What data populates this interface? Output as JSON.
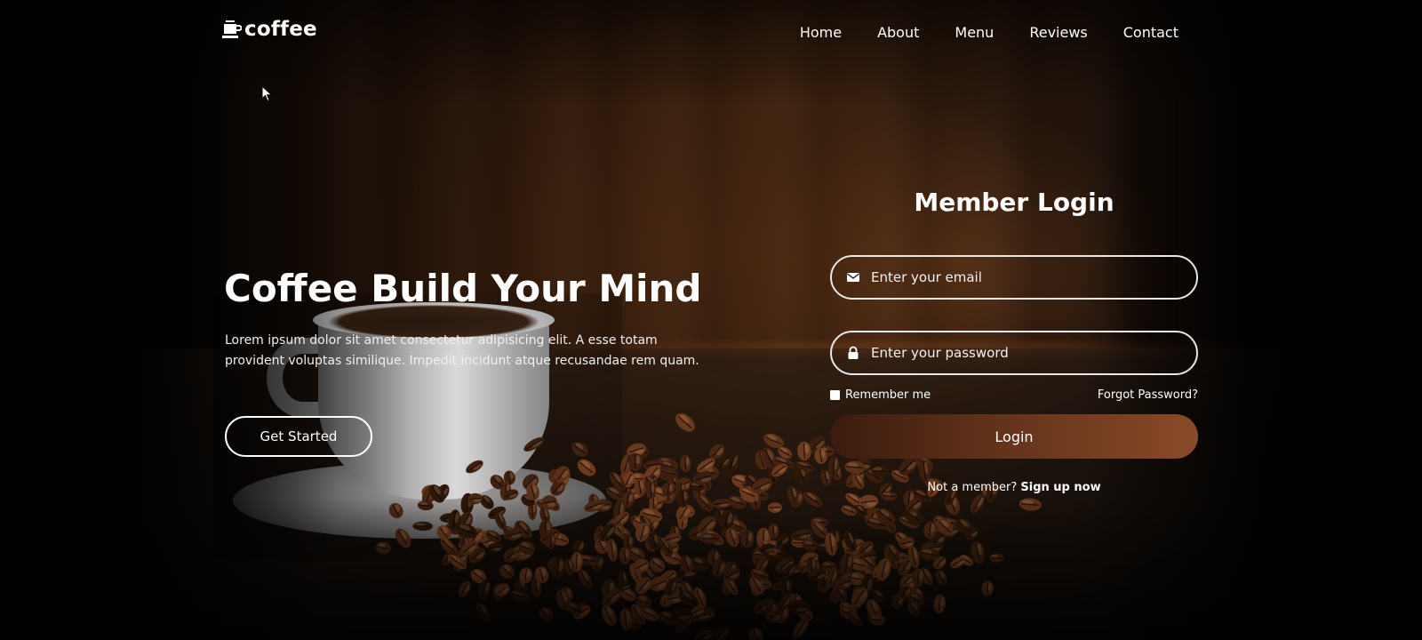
{
  "brand": {
    "name": "coffee",
    "icon": "coffee-cup-icon"
  },
  "nav": {
    "items": [
      {
        "label": "Home"
      },
      {
        "label": "About"
      },
      {
        "label": "Menu"
      },
      {
        "label": "Reviews"
      },
      {
        "label": "Contact"
      }
    ]
  },
  "hero": {
    "title": "Coffee Build Your Mind",
    "description": "Lorem ipsum dolor sit amet consectetur adipisicing elit. A esse totam provident voluptas similique. Impedit incidunt atque recusandae rem quam.",
    "cta_label": "Get Started"
  },
  "login": {
    "title": "Member Login",
    "email": {
      "placeholder": "Enter your email",
      "icon": "envelope-icon"
    },
    "password": {
      "placeholder": "Enter your password",
      "icon": "lock-icon"
    },
    "remember_label": "Remember me",
    "forgot_label": "Forgot Password?",
    "submit_label": "Login",
    "signup_prompt": "Not a member?",
    "signup_link": "Sign up now"
  },
  "colors": {
    "accent_start": "#3a1b0d",
    "accent_end": "#8a4a28",
    "text": "#ffffff",
    "background": "#000000"
  }
}
